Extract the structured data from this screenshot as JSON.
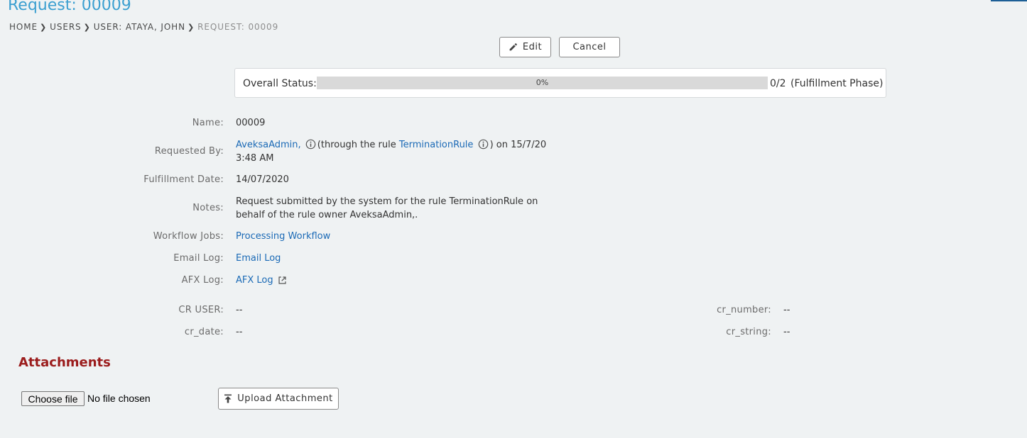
{
  "page": {
    "title": "Request: 00009"
  },
  "breadcrumb": {
    "items": [
      "HOME",
      "USERS",
      "USER: ATAYA, JOHN"
    ],
    "current": "REQUEST: 00009"
  },
  "actions": {
    "edit_label": "Edit",
    "cancel_label": "Cancel"
  },
  "status": {
    "label": "Overall Status:",
    "progress_percent": 0,
    "progress_text": "0%",
    "count": "0/2",
    "phase": "(Fulfillment Phase)"
  },
  "details": {
    "name_label": "Name:",
    "name_value": "00009",
    "requested_by_label": "Requested By:",
    "requested_by_user": "AveksaAdmin,",
    "requested_by_through": "(through the rule",
    "requested_by_rule": "TerminationRule",
    "requested_by_on": ") on 15/7/20",
    "requested_by_time": "3:48 AM",
    "fulfillment_label": "Fulfillment Date:",
    "fulfillment_value": "14/07/2020",
    "notes_label": "Notes:",
    "notes_line1": "Request submitted by the system for the rule TerminationRule on",
    "notes_line2": "behalf of the rule owner AveksaAdmin,.",
    "workflow_label": "Workflow Jobs:",
    "workflow_value": "Processing Workflow",
    "email_label": "Email Log:",
    "email_value": "Email Log",
    "afx_label": "AFX Log:",
    "afx_value": "AFX Log",
    "cr_user_label": "CR USER:",
    "cr_user_value": "--",
    "cr_date_label": "cr_date:",
    "cr_date_value": "--",
    "cr_number_label": "cr_number:",
    "cr_number_value": "--",
    "cr_string_label": "cr_string:",
    "cr_string_value": "--"
  },
  "attachments": {
    "title": "Attachments",
    "choose_file_label": "Choose file",
    "file_status": "No file chosen",
    "upload_label": "Upload Attachment"
  },
  "icons": {
    "edit": "pencil-icon",
    "info": "info-icon",
    "external": "external-link-icon",
    "upload": "upload-icon",
    "breadcrumb_separator": "chevron-right-icon"
  },
  "colors": {
    "title": "#3b9fd0",
    "link": "#1b6ab6",
    "attachments_title": "#9b1c1c",
    "background": "#eff2f3"
  }
}
